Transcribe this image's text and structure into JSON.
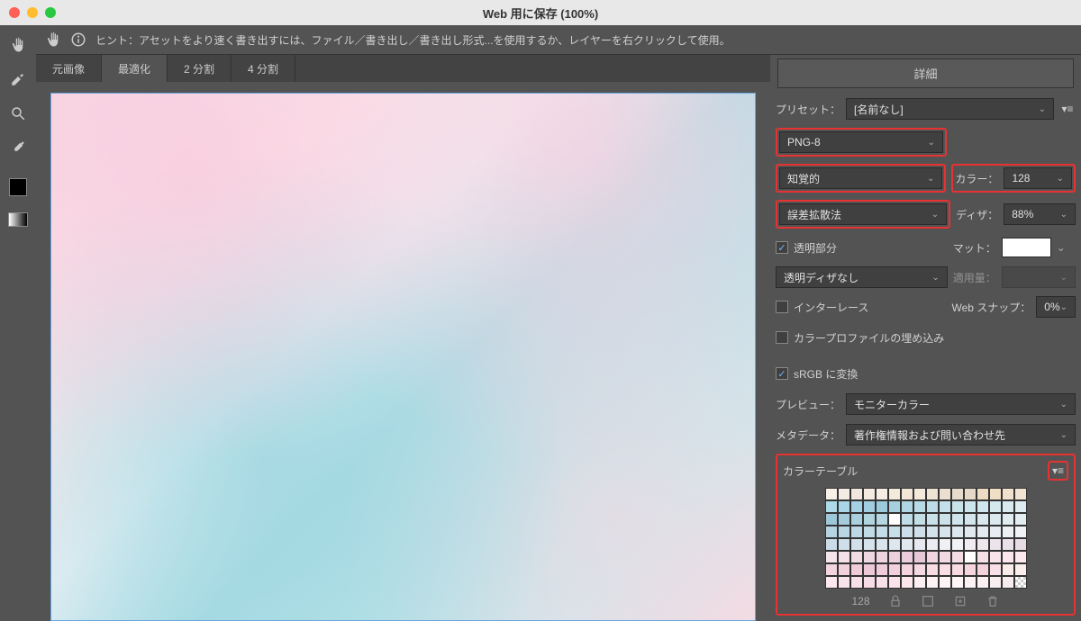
{
  "window": {
    "title": "Web 用に保存 (100%)"
  },
  "hint": {
    "text": "ヒント：アセットをより速く書き出すには、ファイル／書き出し／書き出し形式...を使用するか、レイヤーを右クリックして使用。",
    "detail_button": "詳細"
  },
  "tabs": {
    "original": "元画像",
    "optimized": "最適化",
    "split2": "2 分割",
    "split4": "4 分割"
  },
  "panel": {
    "preset_label": "プリセット：",
    "preset_value": "[名前なし]",
    "format": "PNG-8",
    "reduction": "知覚的",
    "color_label": "カラー：",
    "color_value": "128",
    "dither_method": "誤差拡散法",
    "dither_label": "ディザ：",
    "dither_value": "88%",
    "transparency": "透明部分",
    "matte_label": "マット：",
    "trans_dither": "透明ディザなし",
    "amount_label": "適用量：",
    "interlace": "インターレース",
    "websnap_label": "Web スナップ：",
    "websnap_value": "0%",
    "embed_profile": "カラープロファイルの埋め込み",
    "srgb": "sRGB に変換",
    "preview_label": "プレビュー：",
    "preview_value": "モニターカラー",
    "metadata_label": "メタデータ：",
    "metadata_value": "著作権情報および問い合わせ先",
    "color_table": "カラーテーブル",
    "color_count": "128"
  },
  "swatches": [
    "#f6f0e8",
    "#f2ece4",
    "#f0e8de",
    "#f4ece2",
    "#f6eee4",
    "#f4eadc",
    "#f2e6d6",
    "#f4eadc",
    "#eee4d4",
    "#eadfd0",
    "#e6dbcc",
    "#e4d8c8",
    "#ecdac2",
    "#f0dec6",
    "#f0e0cc",
    "#f2e4d2",
    "#aedae8",
    "#a8d6e6",
    "#a4d2e4",
    "#a0cee0",
    "#9ccadc",
    "#a6d0e0",
    "#b0d6e4",
    "#b8dae6",
    "#bedce8",
    "#c4e0ea",
    "#c8e2ea",
    "#cce4ec",
    "#d0e6ee",
    "#d4e8ee",
    "#d8eaf0",
    "#dcecf0",
    "#9ec8da",
    "#a4ccdc",
    "#aad0de",
    "#b0d4e0",
    "#b6d6e2",
    "#ffffff",
    "#c0dce6",
    "#c4dee8",
    "#c8e0e8",
    "#cce2ea",
    "#d0e4ec",
    "#d4e6ec",
    "#d8e8ee",
    "#dceaf0",
    "#e0ecf0",
    "#e4eef2",
    "#b4d4e2",
    "#b8d6e4",
    "#bcd8e4",
    "#c0dae6",
    "#c4dce8",
    "#c8dee8",
    "#ccdeea",
    "#d0e0ea",
    "#d4e2ec",
    "#d8e4ec",
    "#dce6ee",
    "#e0e8f0",
    "#e4eaf0",
    "#e8ecf2",
    "#ecf0f4",
    "#f0f2f6",
    "#cadce8",
    "#cedeea",
    "#d2e0ea",
    "#d6e2ec",
    "#dae4ec",
    "#dee6ee",
    "#e2e8f0",
    "#e6eaf0",
    "#eaecf2",
    "#eef0f4",
    "#f2f2f6",
    "#f0ecf2",
    "#eee8ee",
    "#ece4ea",
    "#eae0e8",
    "#e8dce4",
    "#f6e4ec",
    "#f4e0e8",
    "#f2dce4",
    "#f0d8e2",
    "#eed4de",
    "#ecd0dc",
    "#eaccda",
    "#e8c8d6",
    "#f0d4e0",
    "#f2d8e2",
    "#f4dce4",
    "#ffffff",
    "#f6e0e8",
    "#f8e4ea",
    "#fae6ec",
    "#fce8ee",
    "#f4d4e0",
    "#f2d0dc",
    "#f0ccd8",
    "#eec8d6",
    "#f0ccda",
    "#f2d0dc",
    "#f4d4de",
    "#f6d8e2",
    "#f8dce4",
    "#fadee6",
    "#f8dae2",
    "#f6d6de",
    "#f4d2dc",
    "#f8e0e8",
    "#faece8",
    "#fceeec",
    "#fce8ee",
    "#fae4ec",
    "#f8e0e8",
    "#f6dce6",
    "#f8e0e8",
    "#fae4ea",
    "#fce8ec",
    "#fef0f2",
    "#fef2f4",
    "#fef4f6",
    "#fef6f8",
    "#fcf2f4",
    "#faf0f2",
    "#f8eef0",
    "#f6ecee",
    "#00000000"
  ]
}
